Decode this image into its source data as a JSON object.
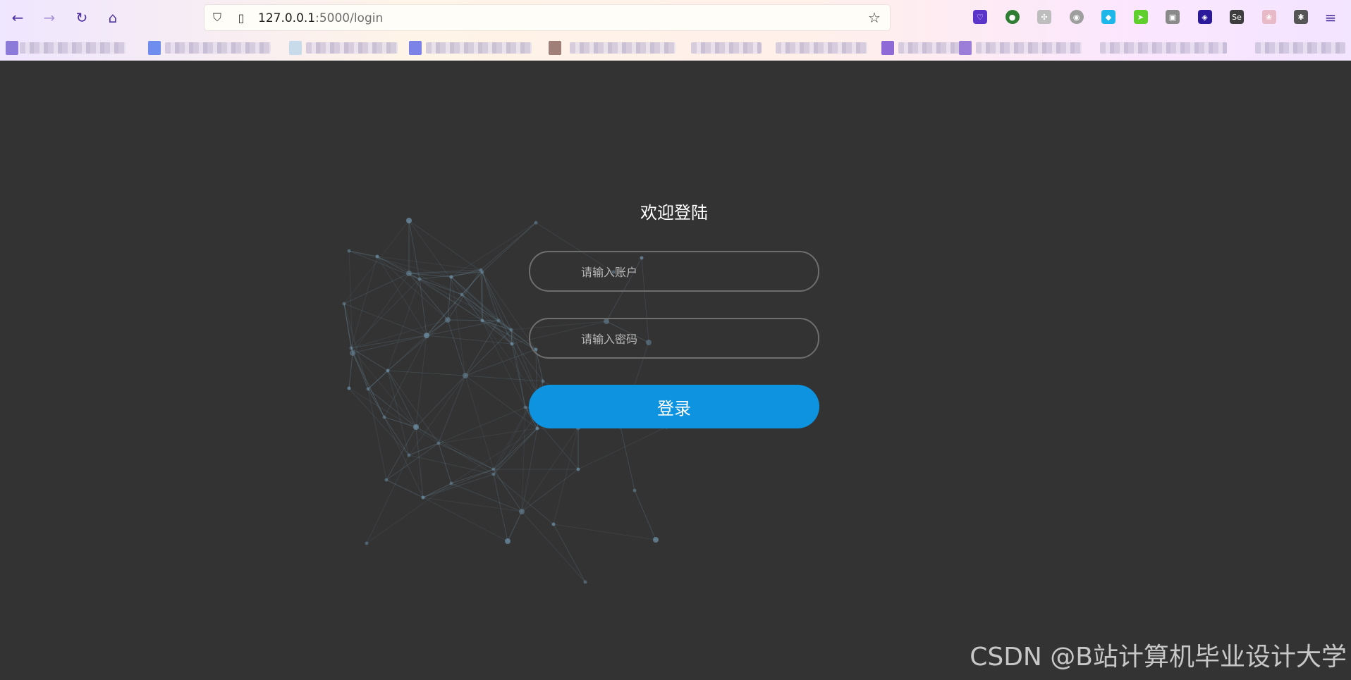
{
  "browser": {
    "url_host": "127.0.0.1",
    "url_path": ":5000/login",
    "colors": {
      "accent": "#4b2e9e"
    },
    "icons": {
      "back": "back-arrow-icon",
      "forward": "forward-arrow-icon",
      "reload": "reload-icon",
      "home": "home-icon",
      "shield": "tracking-shield-icon",
      "page": "page-info-icon",
      "star": "bookmark-star-icon",
      "menu": "hamburger-menu-icon"
    },
    "extensions": [
      {
        "name": "pocket-icon",
        "color": "#5b34c9",
        "glyph": "♡"
      },
      {
        "name": "green-extension-icon",
        "color": "#2f7d32",
        "glyph": "●"
      },
      {
        "name": "network-extension-icon",
        "color": "#bdbdbd",
        "glyph": "✣"
      },
      {
        "name": "circle-extension-icon",
        "color": "#9e9e9e",
        "glyph": "◉"
      },
      {
        "name": "cyan-extension-icon",
        "color": "#1fb6e9",
        "glyph": "◆"
      },
      {
        "name": "green-arrow-extension-icon",
        "color": "#5fcf2e",
        "glyph": "➤"
      },
      {
        "name": "gray-extension-icon",
        "color": "#8a8a8a",
        "glyph": "▣"
      },
      {
        "name": "layers-extension-icon",
        "color": "#2b1b9c",
        "glyph": "◈"
      },
      {
        "name": "selenium-extension-icon",
        "color": "#3d3d3d",
        "glyph": "Se"
      },
      {
        "name": "pink-extension-icon",
        "color": "#e8b9c6",
        "glyph": "❀"
      },
      {
        "name": "bug-extension-icon",
        "color": "#555555",
        "glyph": "✱"
      }
    ]
  },
  "login": {
    "title": "欢迎登陆",
    "account_placeholder": "请输入账户",
    "password_placeholder": "请输入密码",
    "submit_label": "登录",
    "colors": {
      "button": "#0d93df",
      "background": "#333333"
    }
  },
  "watermark": "CSDN @B站计算机毕业设计大学"
}
